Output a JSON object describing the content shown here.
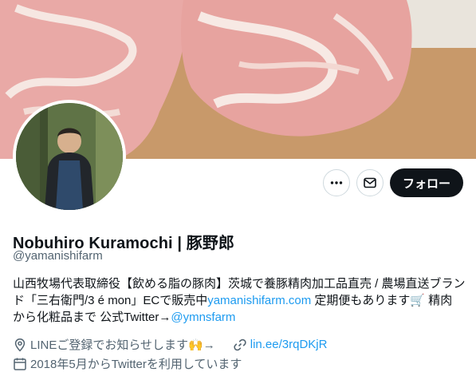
{
  "profile": {
    "display_name": "Nobuhiro Kuramochi | 豚野郎",
    "handle": "@yamanishifarm",
    "bio_line1": "山西牧場代表取締役【飲める脂の豚肉】茨城で養豚精肉加工品直売 / 農場直送ブラン",
    "bio_line2_pre": "ド「三右衛門/3 é mon」ECで販売中",
    "bio_link1": "yamanishifarm.com",
    "bio_line2_post": " 定期便もあります🛒 精肉",
    "bio_line3_pre": "から化粧品まで 公式Twitter→",
    "bio_link2": "@ymnsfarm",
    "location": "LINEご登録でお知らせします🙌→",
    "website": "lin.ee/3rqDKjR",
    "joined": "2018年5月からTwitterを利用しています"
  },
  "actions": {
    "follow_label": "フォロー"
  },
  "icons": [
    "more-icon",
    "mail-icon",
    "location-icon",
    "link-icon",
    "calendar-icon"
  ],
  "colors": {
    "link": "#1d9bf0",
    "muted": "#536471",
    "button": "#0f1419"
  }
}
